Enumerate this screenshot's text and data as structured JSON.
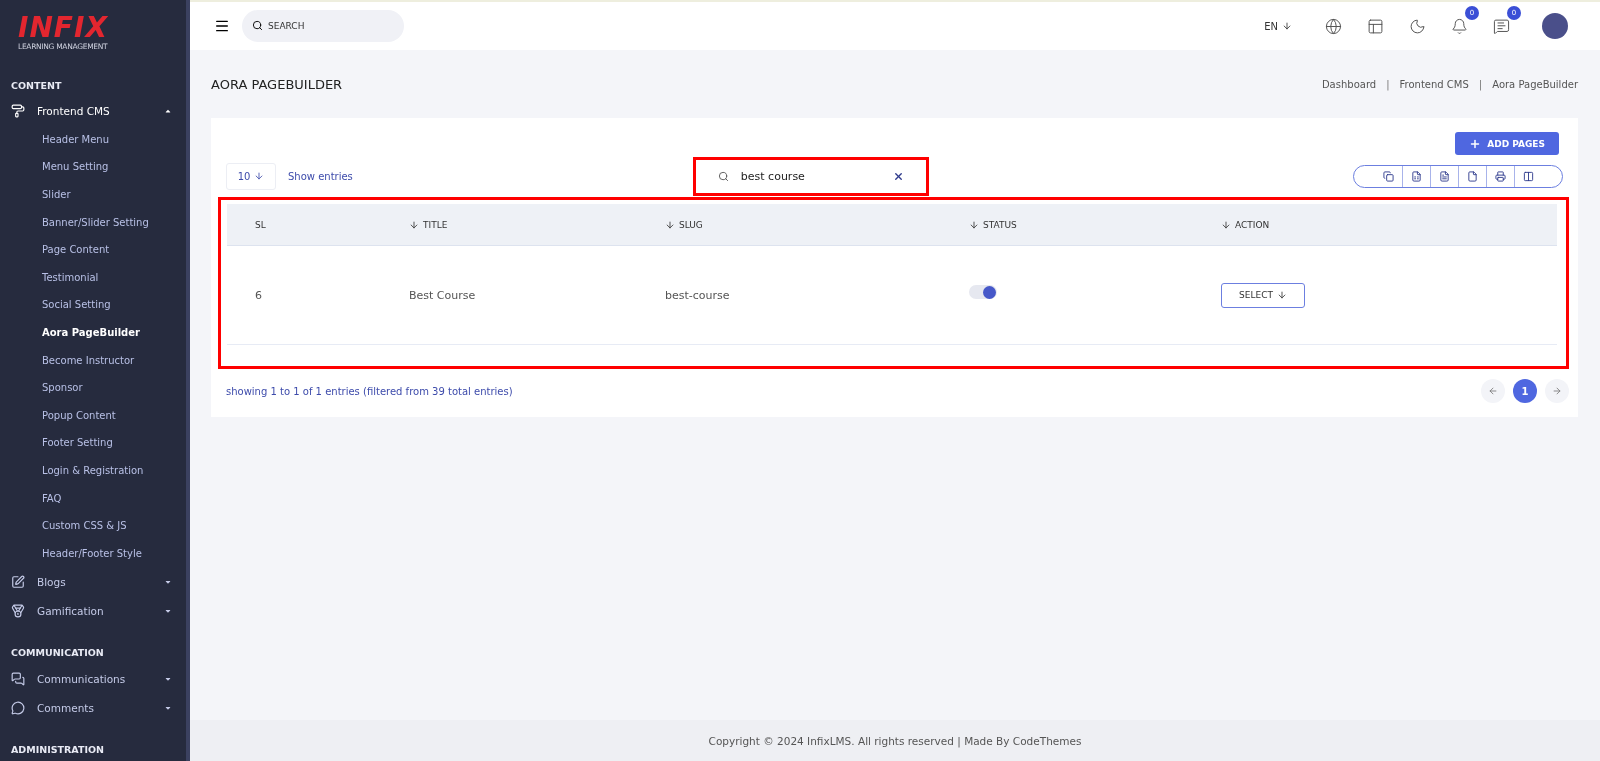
{
  "logo": {
    "title": "INFIX",
    "subtitle": "LEARNING MANAGEMENT"
  },
  "sidebar": {
    "sections": [
      {
        "heading": "CONTENT",
        "items": [
          {
            "label": "Frontend CMS",
            "kind": "roller",
            "expanded": true,
            "children": [
              {
                "label": "Header Menu",
                "selected": false
              },
              {
                "label": "Menu Setting",
                "selected": false
              },
              {
                "label": "Slider",
                "selected": false
              },
              {
                "label": "Banner/Slider Setting",
                "selected": false
              },
              {
                "label": "Page Content",
                "selected": false
              },
              {
                "label": "Testimonial",
                "selected": false
              },
              {
                "label": "Social Setting",
                "selected": false
              },
              {
                "label": "Aora PageBuilder",
                "selected": true
              },
              {
                "label": "Become Instructor",
                "selected": false
              },
              {
                "label": "Sponsor",
                "selected": false
              },
              {
                "label": "Popup Content",
                "selected": false
              },
              {
                "label": "Footer Setting",
                "selected": false
              },
              {
                "label": "Login & Registration",
                "selected": false
              },
              {
                "label": "FAQ",
                "selected": false
              },
              {
                "label": "Custom CSS & JS",
                "selected": false
              },
              {
                "label": "Header/Footer Style",
                "selected": false
              }
            ]
          },
          {
            "label": "Blogs",
            "kind": "edit",
            "expanded": false
          },
          {
            "label": "Gamification",
            "kind": "medal",
            "expanded": false
          }
        ]
      },
      {
        "heading": "COMMUNICATION",
        "items": [
          {
            "label": "Communications",
            "kind": "chats",
            "expanded": false
          },
          {
            "label": "Comments",
            "kind": "comment",
            "expanded": false
          }
        ]
      },
      {
        "heading": "ADMINISTRATION"
      }
    ]
  },
  "topbar": {
    "search": {
      "placeholder": "SEARCH"
    },
    "language": "EN",
    "notifications": "0",
    "messages": "0"
  },
  "page": {
    "title": "AORA PAGEBUILDER",
    "breadcrumbs": [
      "Dashboard",
      "Frontend CMS",
      "Aora PageBuilder"
    ],
    "breadcrumb_separators": [
      "|",
      "|"
    ]
  },
  "toolbar": {
    "add_button": "ADD PAGES",
    "entries": "10",
    "entries_label": "Show entries",
    "search_value": "best course",
    "export_buttons": [
      {
        "kind": "copy"
      },
      {
        "kind": "excel"
      },
      {
        "kind": "csv"
      },
      {
        "kind": "pdf"
      },
      {
        "kind": "print"
      },
      {
        "kind": "columns"
      }
    ]
  },
  "table": {
    "columns": [
      {
        "label": "SL",
        "sortable": false
      },
      {
        "label": "TITLE",
        "sortable": true
      },
      {
        "label": "SLUG",
        "sortable": true
      },
      {
        "label": "STATUS",
        "sortable": true
      },
      {
        "label": "ACTION",
        "sortable": true
      }
    ],
    "rows": [
      {
        "sl": "6",
        "title": "Best Course",
        "slug": "best-course",
        "status_on": true,
        "action": "SELECT"
      }
    ]
  },
  "info": "showing 1 to 1 of 1 entries (filtered from 39 total entries)",
  "pagination": [
    {
      "label": "1",
      "selected": true
    }
  ],
  "footer": "Copyright © 2024 InfixLMS. All rights reserved | Made By CodeThemes"
}
